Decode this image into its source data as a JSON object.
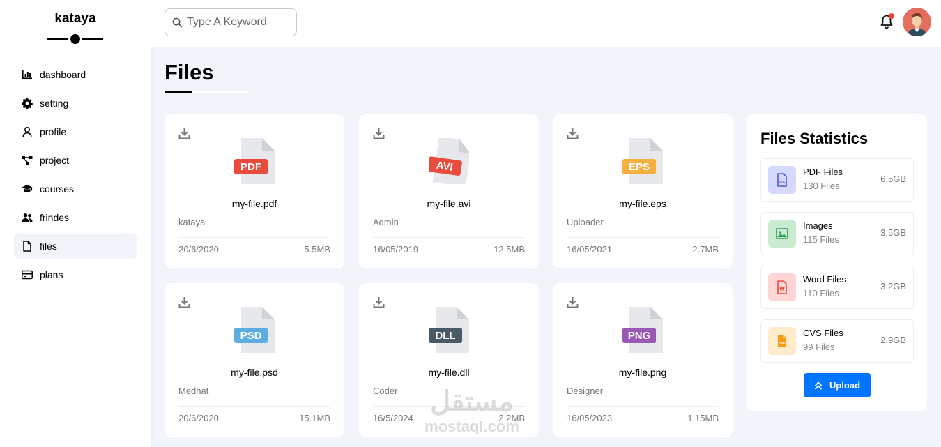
{
  "brand": {
    "name": "kataya"
  },
  "sidebar": {
    "items": [
      {
        "label": "dashboard",
        "icon": "chart-bar-icon"
      },
      {
        "label": "setting",
        "icon": "gear-icon"
      },
      {
        "label": "profile",
        "icon": "user-icon"
      },
      {
        "label": "project",
        "icon": "diagram-project-icon"
      },
      {
        "label": "courses",
        "icon": "graduation-cap-icon"
      },
      {
        "label": "frindes",
        "icon": "users-icon"
      },
      {
        "label": "files",
        "icon": "file-icon",
        "active": true
      },
      {
        "label": "plans",
        "icon": "credit-card-icon"
      }
    ]
  },
  "header": {
    "search": {
      "placeholder": "Type A Keyword"
    },
    "notifications": {
      "has_unread": true
    }
  },
  "page": {
    "title": "Files"
  },
  "files": [
    {
      "name": "my-file.pdf",
      "owner": "kataya",
      "date": "20/6/2020",
      "size": "5.5MB",
      "type": "PDF",
      "color": "#e74c3c"
    },
    {
      "name": "my-file.avi",
      "owner": "Admin",
      "date": "16/05/2019",
      "size": "12.5MB",
      "type": "AVI",
      "color": "#e74c3c"
    },
    {
      "name": "my-file.eps",
      "owner": "Uploader",
      "date": "16/05/2021",
      "size": "2.7MB",
      "type": "EPS",
      "color": "#f5b041"
    },
    {
      "name": "my-file.psd",
      "owner": "Medhat",
      "date": "20/6/2020",
      "size": "15.1MB",
      "type": "PSD",
      "color": "#5dade2"
    },
    {
      "name": "my-file.dll",
      "owner": "Coder",
      "date": "16/5/2024",
      "size": "2.2MB",
      "type": "DLL",
      "color": "#4a5a66"
    },
    {
      "name": "my-file.png",
      "owner": "Designer",
      "date": "16/05/2023",
      "size": "1.15MB",
      "type": "PNG",
      "color": "#9b59b6"
    }
  ],
  "stats": {
    "title": "Files Statistics",
    "items": [
      {
        "name": "PDF Files",
        "count": "130 Files",
        "size": "6.5GB",
        "icon": "file-pdf-icon",
        "bg": "#d6d9ff",
        "fg": "#4f5bd5"
      },
      {
        "name": "Images",
        "count": "115 Files",
        "size": "3.5GB",
        "icon": "image-icon",
        "bg": "#c9ecd1",
        "fg": "#2e9c4f"
      },
      {
        "name": "Word Files",
        "count": "110 Files",
        "size": "3.2GB",
        "icon": "file-word-icon",
        "bg": "#ffd5d5",
        "fg": "#e74c3c"
      },
      {
        "name": "CVS Files",
        "count": "99 Files",
        "size": "2.9GB",
        "icon": "file-csv-icon",
        "bg": "#ffeccb",
        "fg": "#f39c12"
      }
    ],
    "upload_label": "Upload"
  },
  "watermark": {
    "arabic": "مستقل",
    "latin": "mostaql.com"
  },
  "colors": {
    "accent": "#0075ff",
    "background": "#f1f4f9",
    "notification": "#f44336"
  }
}
